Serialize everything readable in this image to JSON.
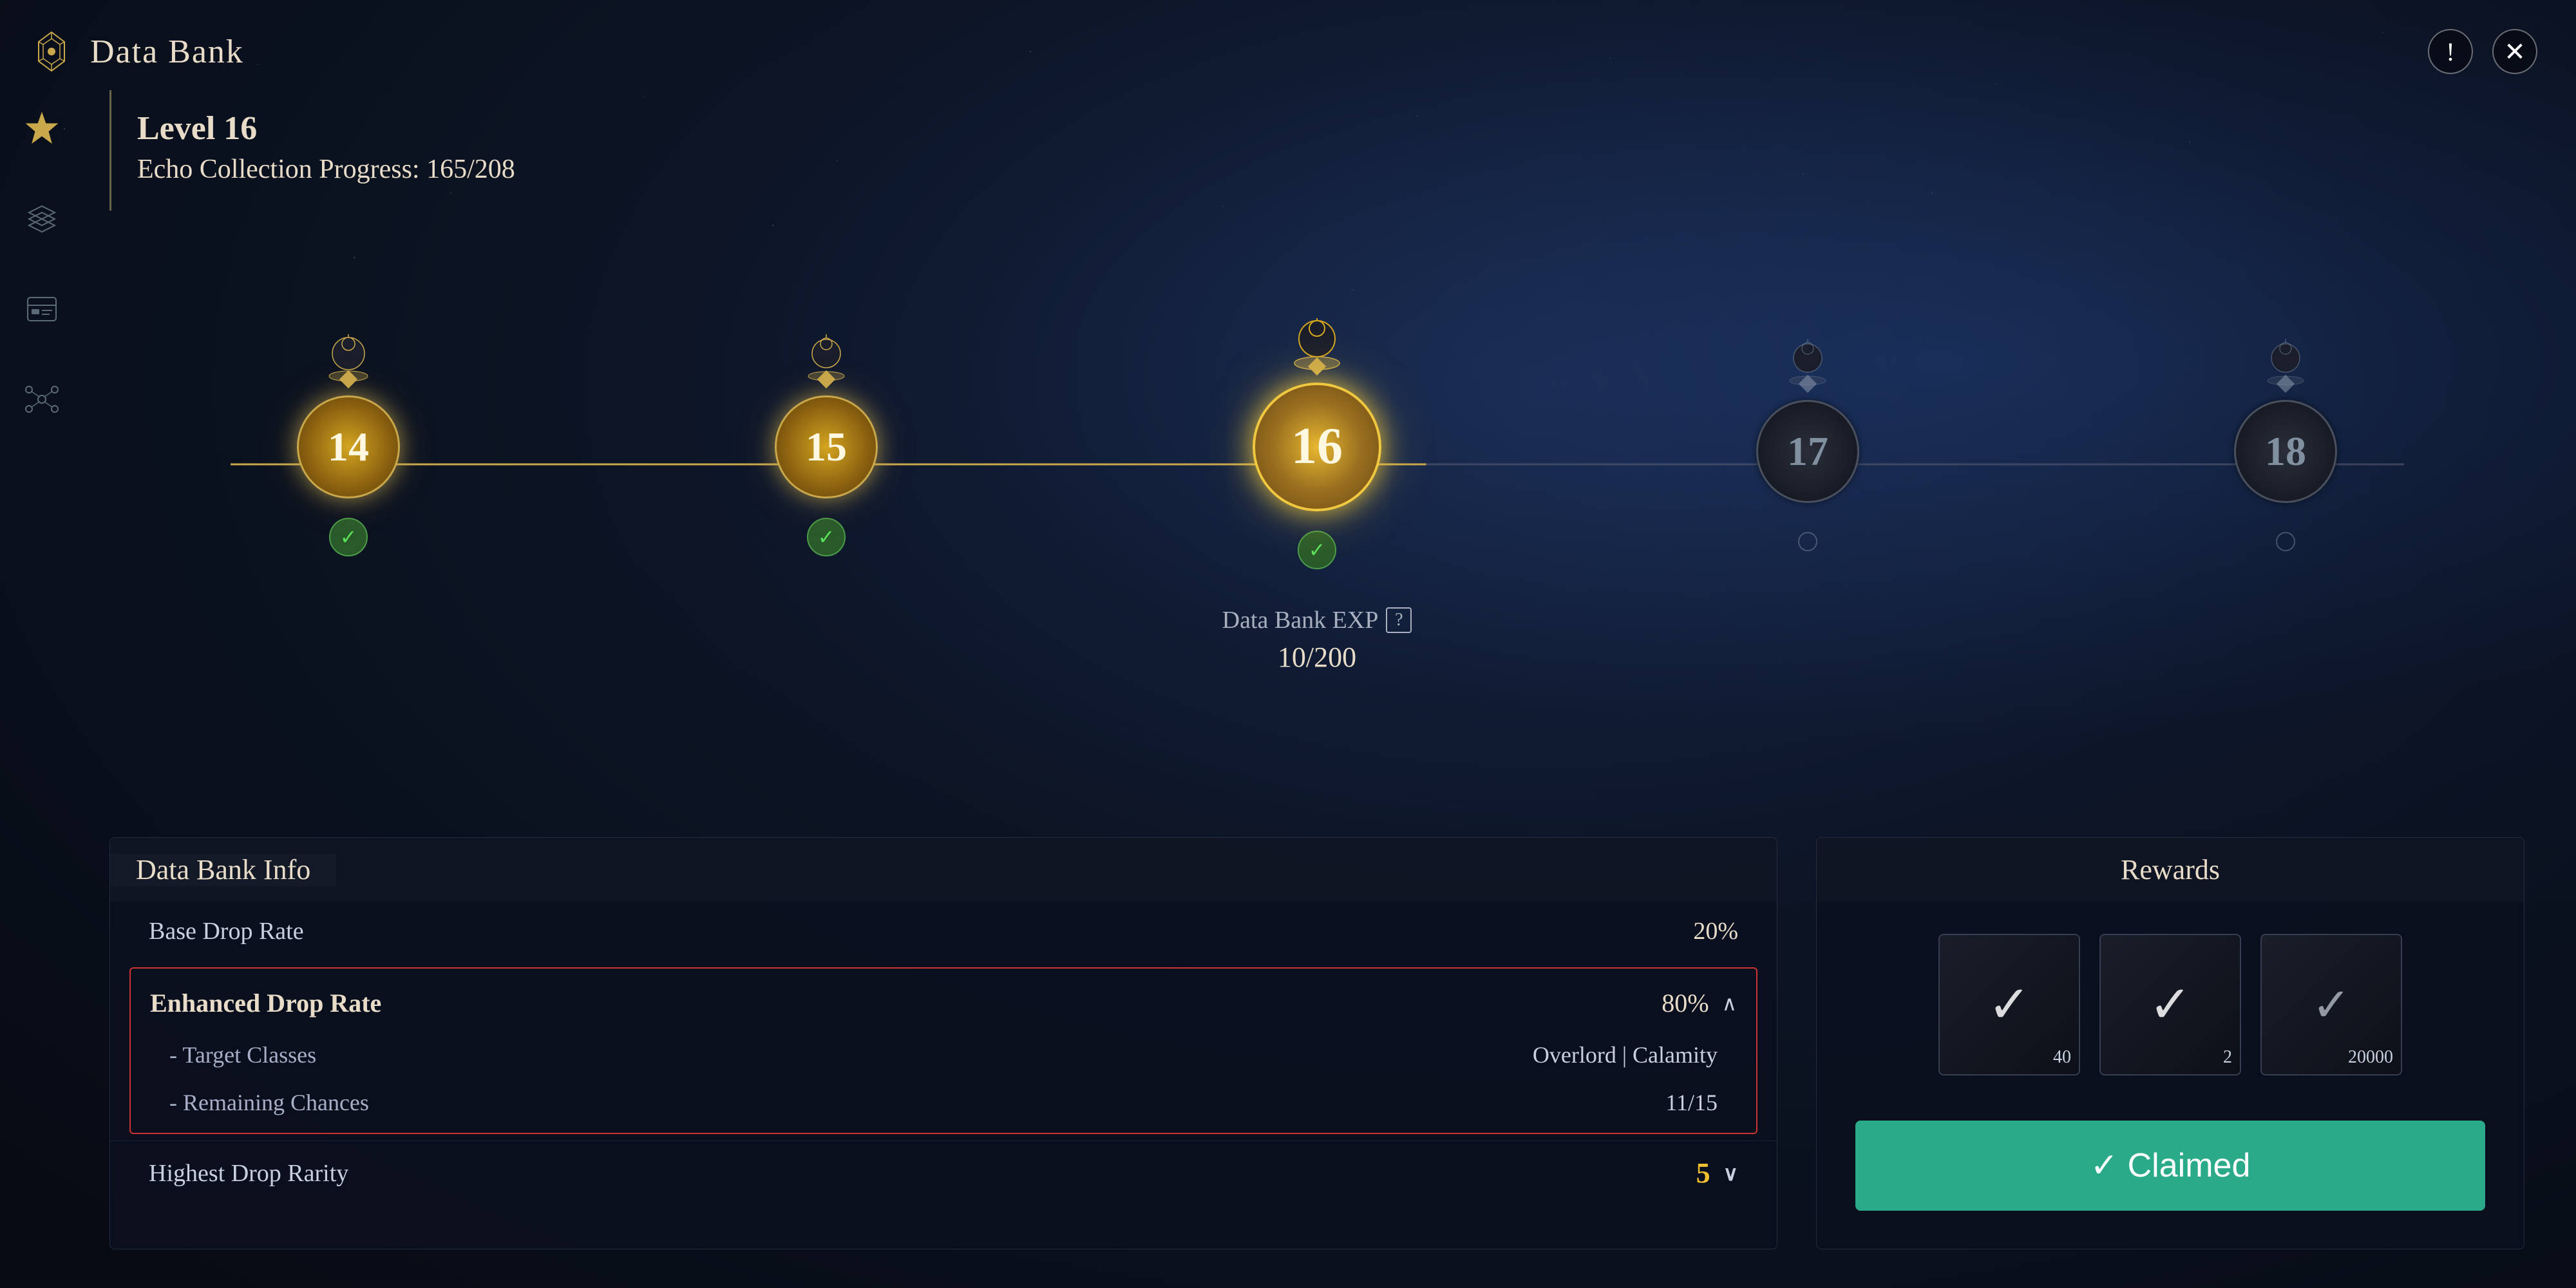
{
  "app": {
    "title": "Data Bank",
    "icon_label": "data-bank-icon"
  },
  "header": {
    "info_button_label": "!",
    "close_button_label": "✕"
  },
  "sidebar": {
    "items": [
      {
        "id": "star-icon",
        "label": "Star"
      },
      {
        "id": "layers-icon",
        "label": "Layers"
      },
      {
        "id": "card-icon",
        "label": "Card"
      },
      {
        "id": "network-icon",
        "label": "Network"
      }
    ]
  },
  "level_info": {
    "level_label": "Level 16",
    "collection_label": "Echo Collection Progress: 165/208"
  },
  "milestones": [
    {
      "number": "14",
      "state": "claimed",
      "has_check": true,
      "has_icon": true
    },
    {
      "number": "15",
      "state": "claimed",
      "has_check": true,
      "has_icon": true
    },
    {
      "number": "16",
      "state": "active",
      "has_check": true,
      "has_icon": true
    },
    {
      "number": "17",
      "state": "locked",
      "has_check": false,
      "has_icon": true
    },
    {
      "number": "18",
      "state": "locked",
      "has_check": false,
      "has_icon": true
    }
  ],
  "exp": {
    "label": "Data Bank EXP",
    "question_mark": "?",
    "value": "10/200"
  },
  "data_bank_info": {
    "panel_title": "Data Bank Info",
    "base_drop_rate_label": "Base Drop Rate",
    "base_drop_rate_value": "20%",
    "enhanced_drop_rate_label": "Enhanced Drop Rate",
    "enhanced_drop_rate_value": "80%",
    "target_classes_label": "- Target Classes",
    "target_classes_value": "Overlord | Calamity",
    "remaining_chances_label": "- Remaining Chances",
    "remaining_chances_value": "11/15",
    "highest_drop_rarity_label": "Highest Drop Rarity",
    "highest_drop_rarity_value": "5"
  },
  "rewards": {
    "panel_title": "Rewards",
    "items": [
      {
        "icon": "✓",
        "count": "40"
      },
      {
        "icon": "✓",
        "count": "2"
      },
      {
        "icon": "✓",
        "count": "20000"
      }
    ],
    "claimed_button_label": "✓ Claimed"
  }
}
